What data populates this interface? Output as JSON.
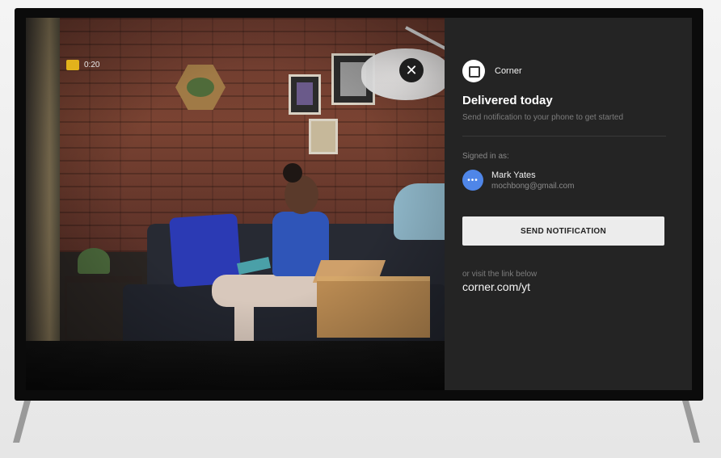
{
  "video": {
    "timer": "0:20",
    "close_icon": "close-icon"
  },
  "panel": {
    "brand_name": "Corner",
    "title": "Delivered today",
    "subtitle": "Send notification to your phone to get started",
    "signed_in_label": "Signed in as:",
    "user": {
      "avatar_text": "•••",
      "name": "Mark Yates",
      "email": "mochbong@gmail.com"
    },
    "send_button": "SEND NOTIFICATION",
    "or_text": "or visit the link below",
    "link": "corner.com/yt"
  },
  "colors": {
    "panel_bg": "#242424",
    "button_bg": "#ececec",
    "avatar_blue": "#4f86e8",
    "timer_badge": "#e2b21b"
  }
}
